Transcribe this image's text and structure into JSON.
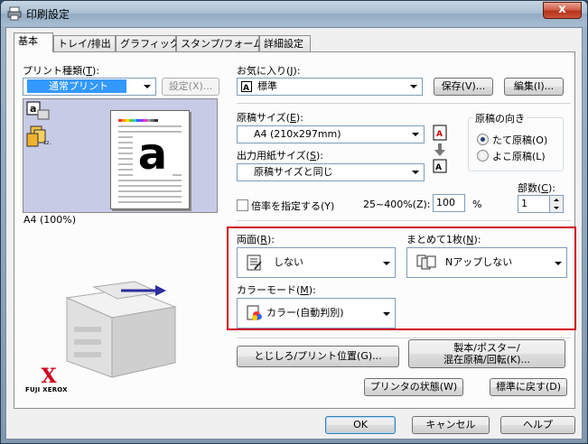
{
  "window": {
    "title": "印刷設定",
    "close_symbol": "x"
  },
  "tabs": [
    "基本",
    "トレイ/排出",
    "グラフィックス",
    "スタンプ/フォーム",
    "詳細設定"
  ],
  "print_type": {
    "label": "プリント種類(",
    "key": "T",
    "label_end": "):",
    "value": "通常プリント",
    "settings_button": "設定(X)..."
  },
  "favorites": {
    "label": "お気に入り(",
    "key": "J",
    "label_end": "):",
    "value": "標準",
    "save_button": "保存(V)...",
    "edit_button": "編集(I)..."
  },
  "preview": {
    "caption": "A4 (100%)",
    "page_letter": "a"
  },
  "original_size": {
    "label": "原稿サイズ(",
    "key": "E",
    "label_end": "):",
    "value": "A4 (210x297mm)"
  },
  "output_size": {
    "label": "出力用紙サイズ(",
    "key": "S",
    "label_end": "):",
    "value": "原稿サイズと同じ"
  },
  "orientation": {
    "title": "原稿の向き",
    "portrait": "たて原稿(O)",
    "landscape": "よこ原稿(L)"
  },
  "copies": {
    "label": "部数(",
    "key": "C",
    "label_end": "):",
    "value": "1"
  },
  "scaling": {
    "checkbox_label": "倍率を指定する(Y)",
    "range_label": "25~400%(Z):",
    "value": "100",
    "unit": "%"
  },
  "duplex": {
    "label": "両面(",
    "key": "R",
    "label_end": "):",
    "value": "しない"
  },
  "nup": {
    "label": "まとめて1枚(",
    "key": "N",
    "label_end": "):",
    "value": "Nアップしない"
  },
  "color_mode": {
    "label": "カラーモード(",
    "key": "M",
    "label_end": "):",
    "value": "カラー(自動判別)"
  },
  "binding_button": "とじしろ/プリント位置(G)...",
  "booklet_button": {
    "line1": "製本/ポスター/",
    "line2": "混在原稿/回転(K)..."
  },
  "printer_status_button": "プリンタの状態(W)",
  "reset_button": "標準に戻す(D)",
  "ok_button": "OK",
  "cancel_button": "キャンセル",
  "help_button": "ヘルプ",
  "brand": {
    "name": "FUJI XEROX",
    "mark": "X"
  }
}
